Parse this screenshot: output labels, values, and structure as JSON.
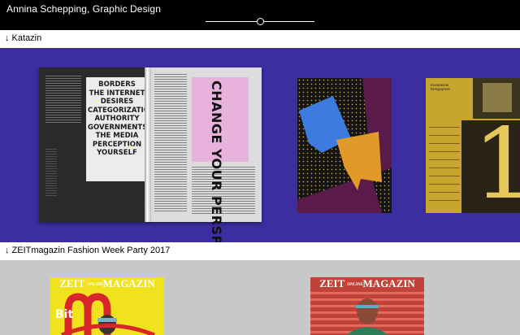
{
  "site": {
    "title": "Annina Schepping, Graphic Design",
    "slider_value": 0.5
  },
  "sections": [
    {
      "title": "↓ Katazin",
      "spread": {
        "poster_words": [
          "BORDERS",
          "THE INTERNET",
          "DESIRES",
          "CATEGORIZATION",
          "AUTHORITY",
          "GOVERNMENTS",
          "THE MEDIA",
          "PERCEPTION",
          "YOURSELF"
        ],
        "vertical_title": "CHANGE YOUR PERSPECTIVE"
      },
      "yellow_poster": {
        "label_line1": "Konstanzer",
        "label_line2": "Designpreis",
        "big_number": "1"
      }
    },
    {
      "title": "↓ ZEITmagazin Fashion Week Party 2017",
      "covers": [
        {
          "masthead_left": "ZEIT",
          "masthead_small": "ONLINE",
          "masthead_right": "MAGAZIN",
          "cover_word": "Bit"
        },
        {
          "masthead_left": "ZEIT",
          "masthead_small": "ONLINE",
          "masthead_right": "MAGAZIN"
        }
      ]
    }
  ],
  "colors": {
    "topbar": "#000000",
    "katazin_bg": "#3c2da0",
    "zeit_bg": "#c8c8c8",
    "accent_yellow": "#f0e21d",
    "accent_red": "#c14238"
  }
}
